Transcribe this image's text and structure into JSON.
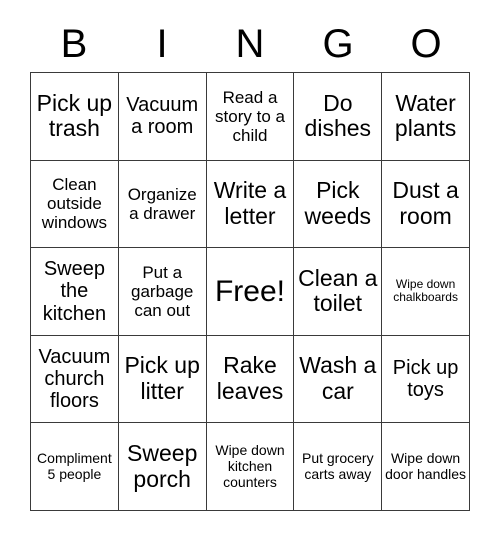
{
  "card": {
    "title_letters": [
      "B",
      "I",
      "N",
      "G",
      "O"
    ],
    "grid_columns": 5,
    "grid_rows": 5,
    "border_color": "#3a3a3a",
    "background_color": "#ffffff",
    "text_color": "#000000",
    "free_space": {
      "label": "Free!",
      "row": 3,
      "column": 3
    },
    "squares": [
      {
        "label": "Pick up trash",
        "size": "xl"
      },
      {
        "label": "Vacuum a room",
        "size": "lg"
      },
      {
        "label": "Read a story to a child",
        "size": "md"
      },
      {
        "label": "Do dishes",
        "size": "xl"
      },
      {
        "label": "Water plants",
        "size": "xl"
      },
      {
        "label": "Clean outside windows",
        "size": "md"
      },
      {
        "label": "Organize a drawer",
        "size": "md"
      },
      {
        "label": "Write a letter",
        "size": "xl"
      },
      {
        "label": "Pick weeds",
        "size": "xl"
      },
      {
        "label": "Dust a room",
        "size": "xl"
      },
      {
        "label": "Sweep the kitchen",
        "size": "lg"
      },
      {
        "label": "Put a garbage can out",
        "size": "md"
      },
      {
        "label": "Free!",
        "size": "free"
      },
      {
        "label": "Clean a toilet",
        "size": "xl"
      },
      {
        "label": "Wipe down chalkboards",
        "size": "xs"
      },
      {
        "label": "Vacuum church floors",
        "size": "lg"
      },
      {
        "label": "Pick up litter",
        "size": "xl"
      },
      {
        "label": "Rake leaves",
        "size": "xl"
      },
      {
        "label": "Wash a car",
        "size": "xl"
      },
      {
        "label": "Pick up toys",
        "size": "lg"
      },
      {
        "label": "Compliment 5 people",
        "size": "sm"
      },
      {
        "label": "Sweep porch",
        "size": "xl"
      },
      {
        "label": "Wipe down kitchen counters",
        "size": "sm"
      },
      {
        "label": "Put grocery carts away",
        "size": "sm"
      },
      {
        "label": "Wipe down door handles",
        "size": "sm"
      }
    ]
  }
}
